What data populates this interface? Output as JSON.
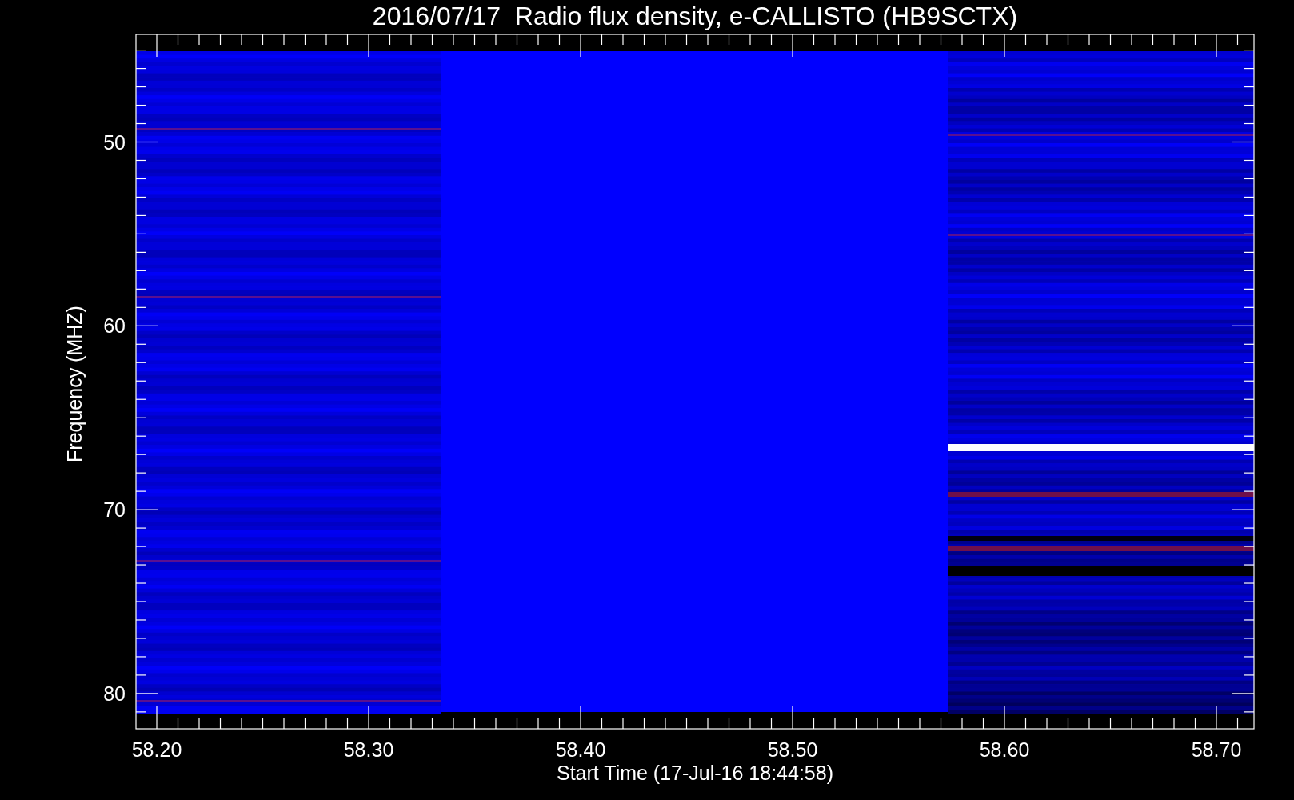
{
  "title": "2016/07/17  Radio flux density, e-CALLISTO (HB9SCTX)",
  "xlabel": "Start Time (17-Jul-16 18:44:58)",
  "ylabel": "Frequency (MHZ)",
  "xticks": [
    "58.20",
    "58.30",
    "58.40",
    "58.50",
    "58.60",
    "58.70"
  ],
  "yticks": [
    "50",
    "60",
    "70",
    "80"
  ]
}
